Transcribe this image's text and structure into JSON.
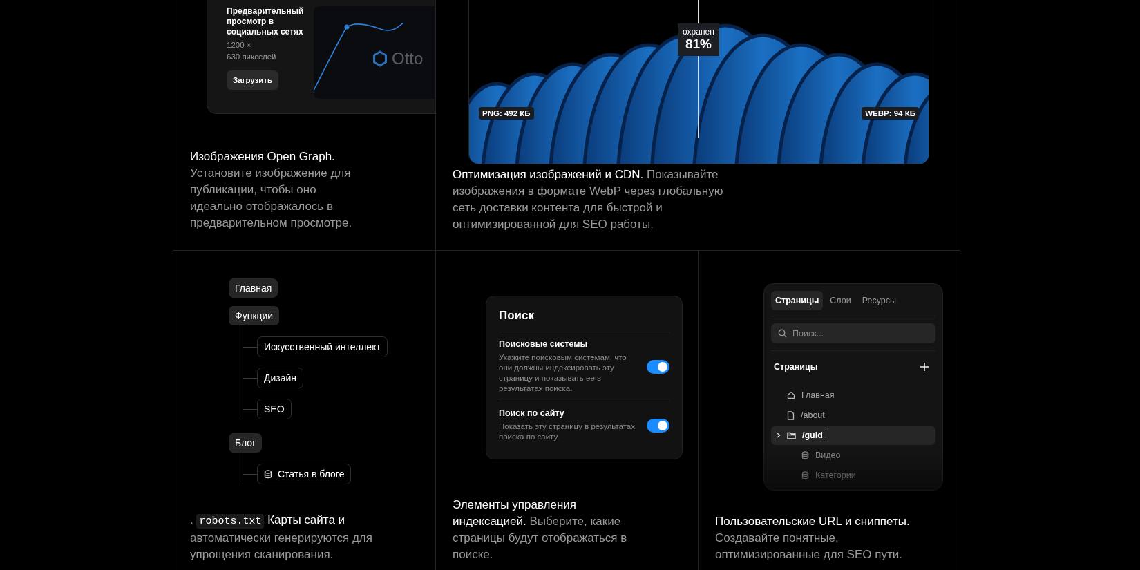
{
  "og_feature": {
    "preview_card": {
      "title": "Предварительный просмотр в социальных сетях",
      "size_line_1": "1200 ×",
      "size_line_2": "630 пикселей",
      "upload_button": "Загрузить",
      "preview_logo": "Otto"
    },
    "caption": {
      "title": "Изображения Open Graph.",
      "text": "Установите изображение для публикации, чтобы оно идеально отображалось в предварительном просмотре."
    }
  },
  "image_feature": {
    "comparison": {
      "savings_label": "охранен",
      "savings_value": "81%",
      "left_label": "PNG: 492 КБ",
      "right_label": "WEBP: 94 КБ"
    },
    "caption": {
      "title": "Оптимизация изображений и CDN.",
      "text": "Показывайте изображения в формате WebP через глобальную сеть доставки контента для быстрой и оптимизированной для SEO работы."
    }
  },
  "sitemap_feature": {
    "tree": [
      {
        "label": "Главная",
        "kind": "section"
      },
      {
        "label": "Функции",
        "kind": "section",
        "children": [
          {
            "label": "Искусственный интеллект",
            "kind": "page"
          },
          {
            "label": "Дизайн",
            "kind": "page"
          },
          {
            "label": "SEO",
            "kind": "page"
          }
        ]
      },
      {
        "label": "Блог",
        "kind": "section",
        "children": [
          {
            "label": "Статья в блоге",
            "kind": "collection"
          }
        ]
      }
    ],
    "caption": {
      "lead": ".",
      "code": "robots.txt",
      "title": "Карты сайта и",
      "text": "автоматически генерируются для упрощения сканирования."
    }
  },
  "indexing_feature": {
    "settings_card": {
      "title": "Поиск",
      "rows": [
        {
          "label": "Поисковые системы",
          "description": "Укажите поисковым системам, что они должны индексировать эту страницу и показывать ее в результатах поиска.",
          "on": true
        },
        {
          "label": "Поиск по сайту",
          "description": "Показать эту страницу в результатах поиска по сайту.",
          "on": true
        }
      ]
    },
    "caption": {
      "title": "Элементы управления индексацией.",
      "text": "Выберите, какие страницы будут отображаться в поиске."
    }
  },
  "url_feature": {
    "panel": {
      "tabs": [
        {
          "label": "Страницы",
          "selected": true
        },
        {
          "label": "Слои",
          "selected": false
        },
        {
          "label": "Ресурсы",
          "selected": false
        }
      ],
      "search": {
        "placeholder": "Поиск..."
      },
      "section_title": "Страницы",
      "pages": [
        {
          "label": "Главная",
          "kind": "home",
          "selected": false
        },
        {
          "label": "/about",
          "kind": "page",
          "selected": false
        },
        {
          "label": "/guid",
          "kind": "folder",
          "selected": true,
          "children": [
            {
              "label": "Видео",
              "kind": "collection",
              "selected": false
            },
            {
              "label": "Категории",
              "kind": "collection",
              "selected": false
            }
          ]
        }
      ]
    },
    "caption": {
      "title": "Пользовательские URL и сниппеты.",
      "text": "Создавайте понятные, оптимизированные для SEO пути."
    }
  }
}
